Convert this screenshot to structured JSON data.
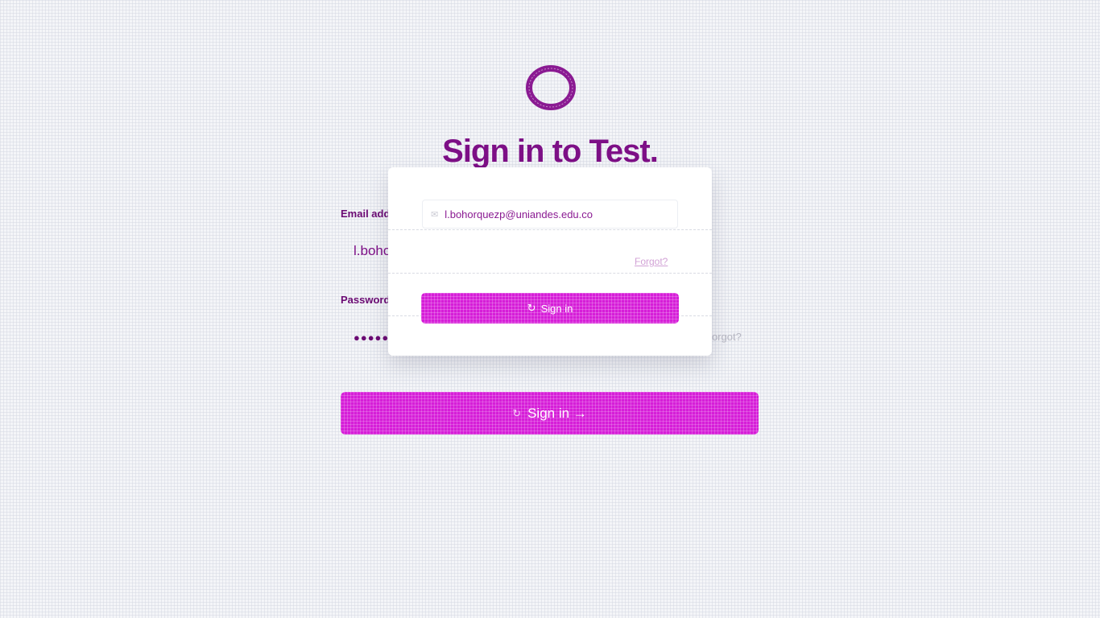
{
  "page": {
    "title": "Sign in to Test."
  },
  "logo": {
    "icon": "circle-logo-icon",
    "color": "#8a1a92"
  },
  "overlay_card": {
    "email_value": "l.bohorquezp@uniandes.edu.co",
    "mail_icon": "✉",
    "forgot_label": "Forgot?",
    "sign_in_icon": "↻",
    "sign_in_label": "Sign in"
  },
  "form": {
    "email_label": "Email address",
    "email_value": "l.bohorquezp@uniandes.edu.co",
    "password_label": "Password",
    "password_value": "●●●●●●●●●●●●●●",
    "forgot_label": "Forgot?",
    "sign_in_icon": "↻",
    "sign_in_label": "Sign in →"
  },
  "colors": {
    "accent": "#d61ed8",
    "text_primary": "#6b0a73",
    "background": "#f4f5f8"
  }
}
